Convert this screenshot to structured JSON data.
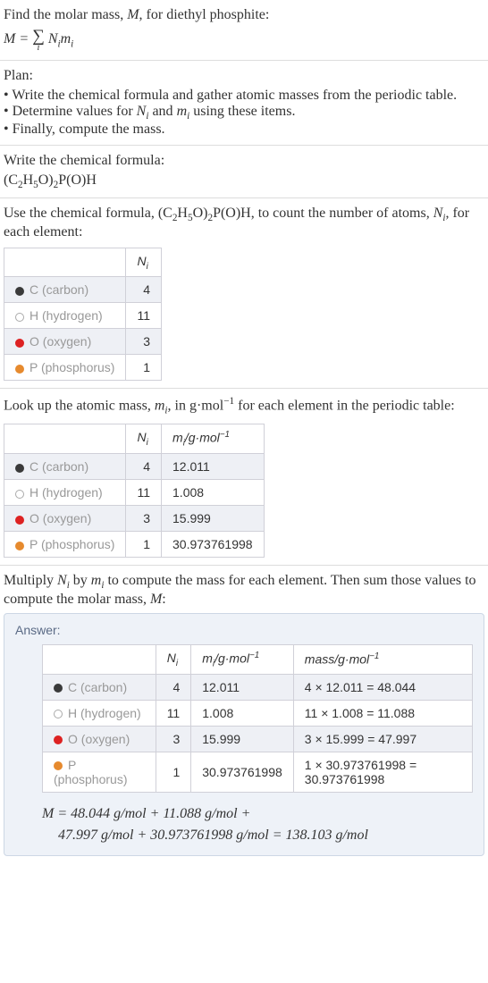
{
  "intro": {
    "line1": "Find the molar mass, ",
    "M": "M",
    "line1b": ", for diethyl phosphite:",
    "eq_lhs": "M = ",
    "eq_sum_under": "i",
    "eq_rhs_N": "N",
    "eq_rhs_i1": "i",
    "eq_rhs_m": "m",
    "eq_rhs_i2": "i"
  },
  "plan": {
    "title": "Plan:",
    "items": [
      "Write the chemical formula and gather atomic masses from the periodic table.",
      "Determine values for Nᵢ and mᵢ using these items.",
      "Finally, compute the mass."
    ]
  },
  "chemformula": {
    "title": "Write the chemical formula:",
    "c2": "(C",
    "sub2a": "2",
    "h5": "H",
    "sub5": "5",
    "o": "O)",
    "sub2b": "2",
    "poh": "P(O)H"
  },
  "count": {
    "prefix": "Use the chemical formula, (C",
    "s2a": "2",
    "h": "H",
    "s5": "5",
    "o": "O)",
    "s2b": "2",
    "suffix": "P(O)H, to count the number of atoms, ",
    "N": "N",
    "i": "i",
    "suffix2": ", for each element:"
  },
  "elements": [
    {
      "name": "C (carbon)",
      "dot": "dot-c",
      "N": "4",
      "m": "12.011",
      "mass": "4 × 12.011 = 48.044"
    },
    {
      "name": "H (hydrogen)",
      "dot": "dot-h",
      "N": "11",
      "m": "1.008",
      "mass": "11 × 1.008 = 11.088"
    },
    {
      "name": "O (oxygen)",
      "dot": "dot-o",
      "N": "3",
      "m": "15.999",
      "mass": "3 × 15.999 = 47.997"
    },
    {
      "name": "P (phosphorus)",
      "dot": "dot-p",
      "N": "1",
      "m": "30.973761998",
      "mass": "1 × 30.973761998 = 30.973761998"
    }
  ],
  "headers": {
    "Ni_N": "N",
    "Ni_i": "i",
    "mi_m": "m",
    "mi_i": "i",
    "mi_unit": "/g·mol",
    "mi_exp": "−1",
    "mass": "mass/g·mol",
    "mass_exp": "−1"
  },
  "lookup": {
    "prefix": "Look up the atomic mass, ",
    "m": "m",
    "i": "i",
    "mid": ", in g·mol",
    "exp": "−1",
    "suffix": " for each element in the periodic table:"
  },
  "multiply": {
    "prefix": "Multiply ",
    "N": "N",
    "i1": "i",
    "by": " by ",
    "m": "m",
    "i2": "i",
    "mid": " to compute the mass for each element. Then sum those values to compute the molar mass, ",
    "M": "M",
    "colon": ":"
  },
  "answer": {
    "label": "Answer:",
    "eq_line1": "M = 48.044 g/mol + 11.088 g/mol +",
    "eq_line2": "47.997 g/mol + 30.973761998 g/mol = 138.103 g/mol"
  }
}
